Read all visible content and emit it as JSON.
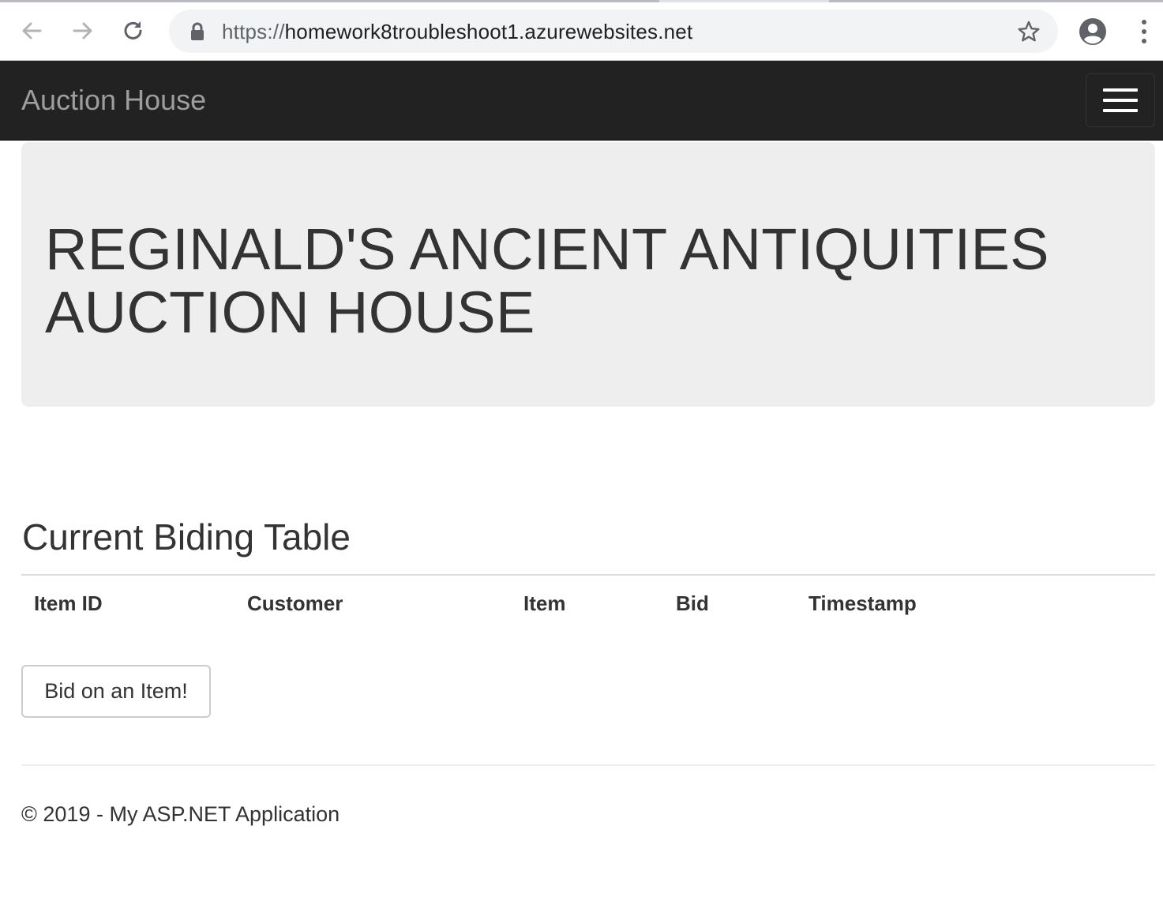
{
  "browser": {
    "url_scheme": "https://",
    "url_host": "homework8troubleshoot1.azurewebsites.net",
    "icons": [
      "back-arrow-icon",
      "forward-arrow-icon",
      "reload-icon",
      "lock-icon",
      "star-icon",
      "profile-icon",
      "menu-dots-icon"
    ]
  },
  "navbar": {
    "brand": "Auction House",
    "toggle_icon": "hamburger-menu-icon"
  },
  "jumbotron": {
    "heading": "REGINALD'S ANCIENT ANTIQUITIES AUCTION HOUSE"
  },
  "main": {
    "section_title": "Current Biding Table",
    "table": {
      "columns": [
        "Item ID",
        "Customer",
        "Item",
        "Bid",
        "Timestamp"
      ],
      "rows": []
    },
    "bid_button_label": "Bid on an Item!"
  },
  "footer": {
    "text": "© 2019 - My ASP.NET Application"
  },
  "colors": {
    "navbar_bg": "#222222",
    "brand_text": "#9d9d9d",
    "jumbotron_bg": "#eeeeee",
    "text": "#333333",
    "omnibox_bg": "#f1f3f4"
  }
}
